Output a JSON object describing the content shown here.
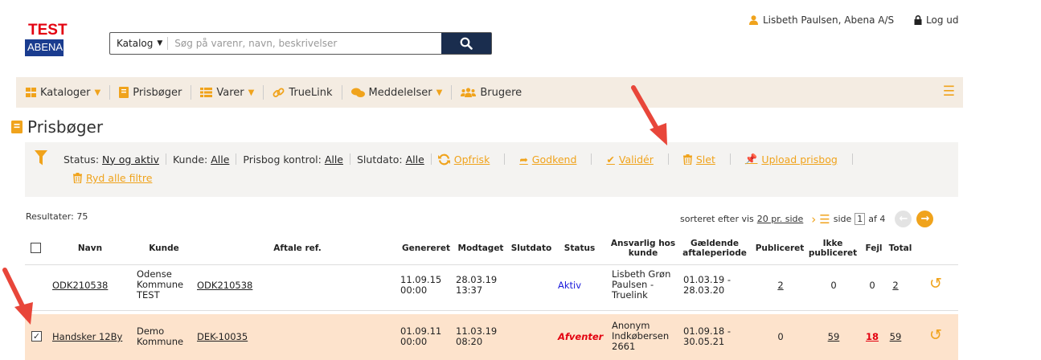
{
  "header": {
    "logo_text": "TEST",
    "logo_sub": "ABENA",
    "search_category": "Katalog",
    "search_placeholder": "Søg på varenr, navn, beskrivelser",
    "user_name": "Lisbeth Paulsen, Abena A/S",
    "logout_label": "Log ud"
  },
  "nav": {
    "items": [
      {
        "label": "Kataloger",
        "icon": "grid-icon",
        "dropdown": true
      },
      {
        "label": "Prisbøger",
        "icon": "book-icon",
        "dropdown": false
      },
      {
        "label": "Varer",
        "icon": "list-icon",
        "dropdown": true
      },
      {
        "label": "TrueLink",
        "icon": "link-icon",
        "dropdown": false
      },
      {
        "label": "Meddelelser",
        "icon": "chat-icon",
        "dropdown": true
      },
      {
        "label": "Brugere",
        "icon": "users-icon",
        "dropdown": false
      }
    ]
  },
  "page": {
    "title": "Prisbøger"
  },
  "filters": {
    "status_label": "Status:",
    "status_value": "Ny og aktiv",
    "kunde_label": "Kunde:",
    "kunde_value": "Alle",
    "kontrol_label": "Prisbog kontrol:",
    "kontrol_value": "Alle",
    "slutdato_label": "Slutdato:",
    "slutdato_value": "Alle",
    "clear_label": "Ryd alle filtre"
  },
  "actions": {
    "refresh": "Opfrisk",
    "approve": "Godkend",
    "validate": "Validér",
    "delete": "Slet",
    "upload": "Upload prisbog"
  },
  "results": {
    "label": "Resultater: 75",
    "sort_prefix": "sorteret efter vis",
    "per_page": "20 pr. side",
    "page_label": "side",
    "page_value": "1",
    "page_of": "af 4"
  },
  "table": {
    "headers": {
      "navn": "Navn",
      "kunde": "Kunde",
      "aftale": "Aftale ref.",
      "genereret": "Genereret",
      "modtaget": "Modtaget",
      "slutdato": "Slutdato",
      "status": "Status",
      "ansvarlig1": "Ansvarlig hos",
      "ansvarlig2": "kunde",
      "periode1": "Gældende",
      "periode2": "aftaleperiode",
      "publiceret": "Publiceret",
      "ikke1": "Ikke",
      "ikke2": "publiceret",
      "fejl": "Fejl",
      "total": "Total"
    },
    "rows": [
      {
        "checked": false,
        "navn": "ODK210538",
        "kunde1": "Odense",
        "kunde2": "Kommune",
        "kunde3": "TEST",
        "aftale": "ODK210538",
        "gen1": "11.09.15",
        "gen2": "00:00",
        "mod1": "28.03.19",
        "mod2": "13:37",
        "status": "Aktiv",
        "ans1": "Lisbeth Grøn",
        "ans2": "Paulsen -",
        "ans3": "Truelink",
        "per1": "01.03.19 -",
        "per2": "28.03.20",
        "publiceret": "2",
        "ikke": "0",
        "fejl": "0",
        "total": "2"
      },
      {
        "checked": true,
        "navn": "Handsker 12By",
        "kunde1": "Demo",
        "kunde2": "Kommune",
        "kunde3": "",
        "aftale": "DEK-10035",
        "gen1": "01.09.11",
        "gen2": "00:00",
        "mod1": "11.03.19",
        "mod2": "08:20",
        "status": "Afventer",
        "ans1": "Anonym",
        "ans2": "Indkøbersen",
        "ans3": "2661",
        "per1": "01.09.18 -",
        "per2": "30.05.21",
        "publiceret": "0",
        "ikke": "59",
        "fejl": "18",
        "total": "59"
      }
    ]
  },
  "colors": {
    "accent": "#f0a31c",
    "brand_red": "#e3000f",
    "brand_blue": "#1a3c8f",
    "nav_bg": "#f4ece2",
    "selected_row": "#fde3cc",
    "arrow": "#e8463a",
    "active_blue": "#1a1adb"
  }
}
